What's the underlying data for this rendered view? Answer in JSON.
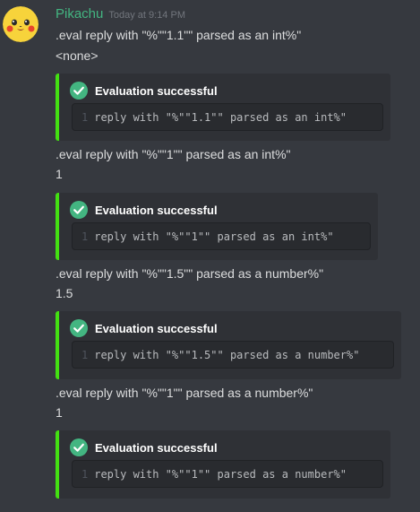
{
  "message": {
    "username": "Pikachu",
    "timestamp": "Today at 9:14 PM",
    "colors": {
      "username": "#43b581",
      "embed_border": "#43e012",
      "check": "#43b581",
      "background": "#36393f",
      "embed_background": "#2f3136"
    }
  },
  "blocks": [
    {
      "command": ".eval reply with \"%\"\"1.1\"\" parsed as an int%\"",
      "result": "<none>",
      "embed_title": "Evaluation successful",
      "line_number": "1",
      "code": "reply with \"%\"\"1.1\"\" parsed as an int%\""
    },
    {
      "command": ".eval reply with \"%\"\"1\"\" parsed as an int%\"",
      "result": "1",
      "embed_title": "Evaluation successful",
      "line_number": "1",
      "code": "reply with \"%\"\"1\"\" parsed as an int%\""
    },
    {
      "command": ".eval reply with \"%\"\"1.5\"\" parsed as a number%\"",
      "result": "1.5",
      "embed_title": "Evaluation successful",
      "line_number": "1",
      "code": "reply with \"%\"\"1.5\"\" parsed as a number%\""
    },
    {
      "command": ".eval reply with \"%\"\"1\"\" parsed as a number%\"",
      "result": "1",
      "embed_title": "Evaluation successful",
      "line_number": "1",
      "code": "reply with \"%\"\"1\"\" parsed as a number%\""
    }
  ],
  "icons": {
    "avatar": "pikachu-face-icon",
    "embed": "check-circle-icon"
  }
}
